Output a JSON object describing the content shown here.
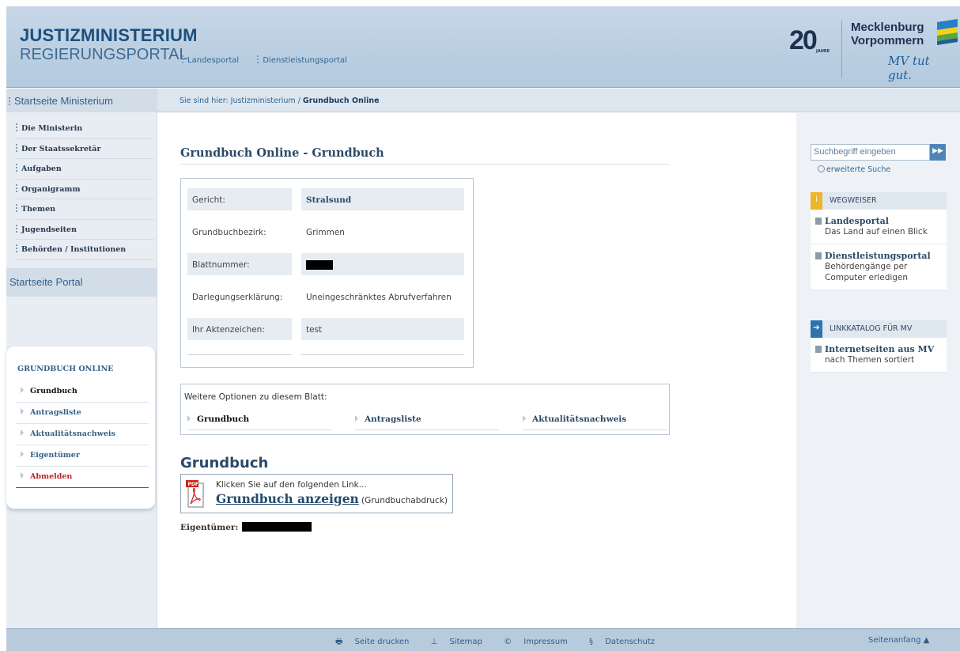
{
  "header": {
    "brand_line1": "JUSTIZMINISTERIUM",
    "brand_line2": "REGIERUNGSPORTAL",
    "links": [
      "Landesportal",
      "Dienstleistungsportal"
    ],
    "logo_number": "20",
    "logo_jahre": "JAHRE",
    "logo_state_line1": "Mecklenburg",
    "logo_state_line2": "Vorpommern",
    "logo_slogan": "MV tut gut."
  },
  "breadcrumb": {
    "prefix": "Sie sind hier: Justizministerium / ",
    "current": "Grundbuch Online"
  },
  "sidebar": {
    "home_label": "Startseite Ministerium",
    "items": [
      "Die Ministerin",
      "Der Staatssekretär",
      "Aufgaben",
      "Organigramm",
      "Themen",
      "Jugendseiten",
      "Behörden / Institutionen"
    ],
    "portal_label": "Startseite Portal",
    "box_title": "GRUNDBUCH ONLINE",
    "box_items": [
      "Grundbuch",
      "Antragsliste",
      "Aktualitätsnachweis",
      "Eigentümer",
      "Abmelden"
    ],
    "active_item": "Grundbuch"
  },
  "main": {
    "title": "Grundbuch Online - Grundbuch",
    "details": [
      {
        "label": "Gericht:",
        "value": "Stralsund"
      },
      {
        "label": "Grundbuchbezirk:",
        "value": "Grimmen"
      },
      {
        "label": "Blattnummer:",
        "value": ""
      },
      {
        "label": "Darlegungserklärung:",
        "value": "Uneingeschränktes Abrufverfahren"
      },
      {
        "label": "Ihr Aktenzeichen:",
        "value": "test"
      }
    ],
    "options_title": "Weitere Optionen zu diesem Blatt:",
    "options": [
      "Grundbuch",
      "Antragsliste",
      "Aktualitätsnachweis"
    ],
    "section_title": "Grundbuch",
    "pdf_badge": "PDF",
    "pdf_hint": "Klicken Sie auf den folgenden Link...",
    "pdf_link": "Grundbuch anzeigen",
    "pdf_note": "(Grundbuchabdruck)",
    "owner_label": "Eigentümer:"
  },
  "right": {
    "search_placeholder": "Suchbegriff eingeben",
    "advanced_search": "erweiterte Suche",
    "guide_title": "WEGWEISER",
    "guide_items": [
      {
        "title": "Landesportal",
        "subtitle": "Das Land auf einen Blick"
      },
      {
        "title": "Dienstleistungsportal",
        "subtitle": "Behördengänge per Computer erledigen"
      }
    ],
    "catalog_title": "LINKKATALOG FÜR MV",
    "catalog_items": [
      {
        "title": "Internetseiten aus MV",
        "subtitle": "nach Themen sortiert"
      }
    ]
  },
  "footer": {
    "links": [
      "Seite drucken",
      "Sitemap",
      "Impressum",
      "Datenschutz"
    ],
    "top_link": "Seitenanfang ▲"
  },
  "colors": {
    "brand": "#1c4f7d",
    "header_bg": "#c6d7e7",
    "logout": "#b8242b",
    "guide_icon": "#f0b428",
    "catalog_icon": "#2e73ad"
  }
}
